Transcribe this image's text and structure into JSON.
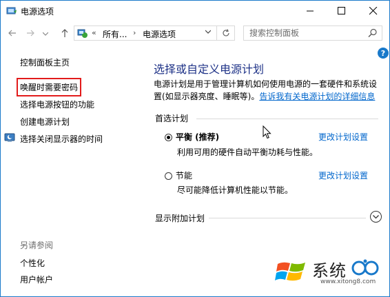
{
  "window": {
    "title": "电源选项"
  },
  "address": {
    "crumb_prefix": "«",
    "part1": "所有...",
    "separator": "›",
    "part2": "电源选项"
  },
  "search": {
    "placeholder": "搜索控制面板"
  },
  "sidebar": {
    "items": [
      {
        "label": "控制面板主页"
      },
      {
        "label": "唤醒时需要密码"
      },
      {
        "label": "选择电源按钮的功能"
      },
      {
        "label": "创建电源计划"
      },
      {
        "label": "选择关闭显示器的时间"
      }
    ],
    "see_also_title": "另请参阅",
    "see_also": [
      {
        "label": "个性化"
      },
      {
        "label": "用户帐户"
      }
    ]
  },
  "main": {
    "title": "选择或自定义电源计划",
    "description": "电源计划是用于管理计算机如何使用电源的一套硬件和系统设置(如显示器亮度、睡眠等)。",
    "description_link": "告诉我有关电源计划的详细信息",
    "preferred_label": "首选计划",
    "plans": [
      {
        "name": "平衡 (推荐)",
        "desc": "利用可用的硬件自动平衡功耗与性能。",
        "link": "更改计划设置",
        "selected": true
      },
      {
        "name": "节能",
        "desc": "尽可能降低计算机性能以节能。",
        "link": "更改计划设置",
        "selected": false
      }
    ],
    "more_plans_label": "显示附加计划"
  },
  "watermark": {
    "text": "系统",
    "url": "www.xitong8.com"
  },
  "colors": {
    "accent": "#1979ca",
    "link": "#0066cc",
    "title": "#1e3287",
    "highlight": "#e21b1b"
  }
}
